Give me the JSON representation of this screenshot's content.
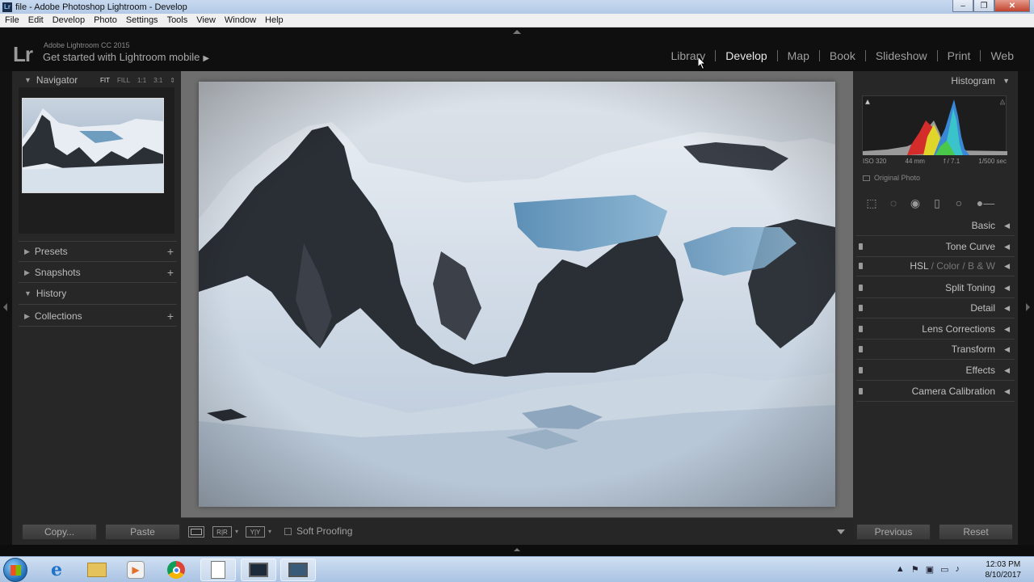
{
  "window": {
    "title": "file - Adobe Photoshop Lightroom - Develop",
    "icon_text": "Lr"
  },
  "menubar": [
    "File",
    "Edit",
    "Develop",
    "Photo",
    "Settings",
    "Tools",
    "View",
    "Window",
    "Help"
  ],
  "identity": {
    "logo": "Lr",
    "version": "Adobe Lightroom CC 2015",
    "mobile": "Get started with Lightroom mobile",
    "mobile_arrow": "▶"
  },
  "modules": [
    {
      "label": "Library",
      "active": false
    },
    {
      "label": "Develop",
      "active": true
    },
    {
      "label": "Map",
      "active": false
    },
    {
      "label": "Book",
      "active": false
    },
    {
      "label": "Slideshow",
      "active": false
    },
    {
      "label": "Print",
      "active": false
    },
    {
      "label": "Web",
      "active": false
    }
  ],
  "left_panel": {
    "navigator": {
      "label": "Navigator",
      "zoom": [
        "FIT",
        "FILL",
        "1:1",
        "3:1"
      ],
      "zoom_selected": "FIT"
    },
    "presets": "Presets",
    "snapshots": "Snapshots",
    "history": "History",
    "collections": "Collections",
    "copy_label": "Copy...",
    "paste_label": "Paste"
  },
  "toolbar": {
    "soft_proofing": "Soft Proofing",
    "before_after_1": "R|R",
    "before_after_2": "Y|Y"
  },
  "right_panel": {
    "histogram": "Histogram",
    "iso": "ISO 320",
    "focal": "44 mm",
    "aperture": "f / 7.1",
    "shutter": "1/500 sec",
    "original_photo": "Original Photo",
    "sections": {
      "basic": "Basic",
      "tone_curve": "Tone Curve",
      "hsl": "HSL",
      "color": "Color",
      "bw": "B & W",
      "split_toning": "Split Toning",
      "detail": "Detail",
      "lens_corrections": "Lens Corrections",
      "transform": "Transform",
      "effects": "Effects",
      "camera_calibration": "Camera Calibration"
    },
    "previous_label": "Previous",
    "reset_label": "Reset"
  },
  "taskbar": {
    "time": "12:03 PM",
    "date": "8/10/2017"
  },
  "colors": {
    "panel_bg": "#272727",
    "center_bg": "#6e6e6e",
    "active_module": "#e8e8e8"
  }
}
